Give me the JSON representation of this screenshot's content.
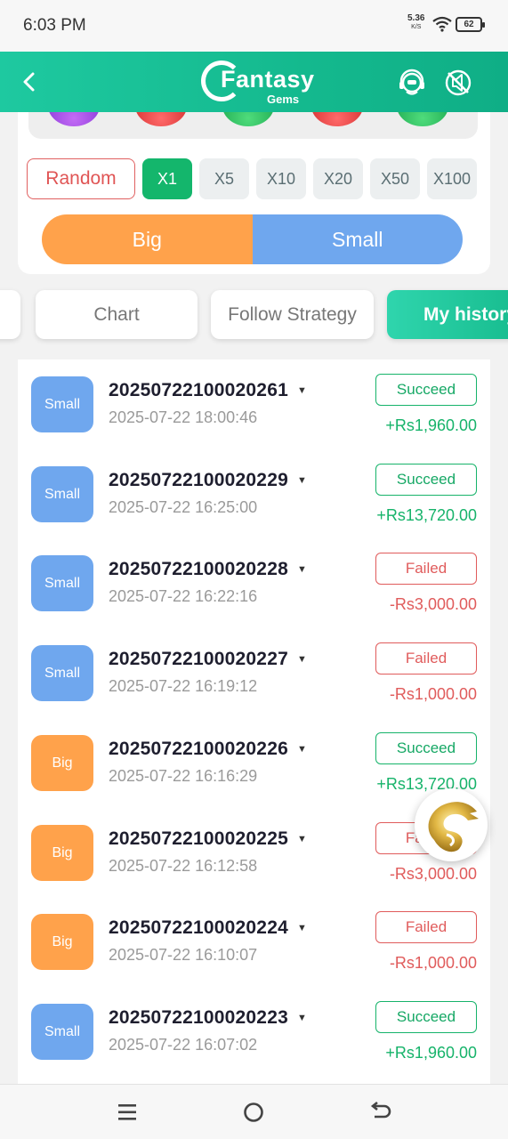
{
  "status_bar": {
    "time": "6:03 PM",
    "net_speed": "5.36",
    "net_unit": "K/S",
    "battery": "62",
    "icons": [
      "wifi-icon",
      "battery-icon"
    ]
  },
  "header": {
    "logo_main": "Fantasy",
    "logo_sub": "Gems",
    "back_icon": "chevron-left-icon",
    "right_icons": [
      "support-agent-icon",
      "sound-off-icon"
    ]
  },
  "panel": {
    "random_label": "Random",
    "multipliers": [
      "X1",
      "X5",
      "X10",
      "X20",
      "X50",
      "X100"
    ],
    "selected_multiplier": "X1",
    "big_label": "Big",
    "small_label": "Small"
  },
  "tabs": {
    "items": [
      "Chart",
      "Follow Strategy",
      "My history"
    ],
    "active": "My history"
  },
  "history": [
    {
      "type": "Small",
      "period": "20250722100020261",
      "time": "2025-07-22 18:00:46",
      "status": "Succeed",
      "amount": "+Rs1,960.00"
    },
    {
      "type": "Small",
      "period": "20250722100020229",
      "time": "2025-07-22 16:25:00",
      "status": "Succeed",
      "amount": "+Rs13,720.00"
    },
    {
      "type": "Small",
      "period": "20250722100020228",
      "time": "2025-07-22 16:22:16",
      "status": "Failed",
      "amount": "-Rs3,000.00"
    },
    {
      "type": "Small",
      "period": "20250722100020227",
      "time": "2025-07-22 16:19:12",
      "status": "Failed",
      "amount": "-Rs1,000.00"
    },
    {
      "type": "Big",
      "period": "20250722100020226",
      "time": "2025-07-22 16:16:29",
      "status": "Succeed",
      "amount": "+Rs13,720.00"
    },
    {
      "type": "Big",
      "period": "20250722100020225",
      "time": "2025-07-22 16:12:58",
      "status": "Failed",
      "amount": "-Rs3,000.00"
    },
    {
      "type": "Big",
      "period": "20250722100020224",
      "time": "2025-07-22 16:10:07",
      "status": "Failed",
      "amount": "-Rs1,000.00"
    },
    {
      "type": "Small",
      "period": "20250722100020223",
      "time": "2025-07-22 16:07:02",
      "status": "Succeed",
      "amount": "+Rs1,960.00"
    }
  ],
  "floating_button_icon": "dragon-logo-icon",
  "nav_icons": [
    "menu-icon",
    "home-circle-icon",
    "back-arrow-icon"
  ],
  "colors": {
    "header": "#14b98e",
    "big": "#ffa24b",
    "small": "#6fa7ee",
    "success": "#16b36a",
    "failure": "#e05b5b"
  }
}
